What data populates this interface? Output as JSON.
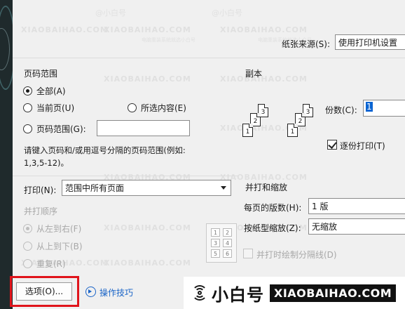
{
  "paper_source": {
    "label": "纸张来源(S):",
    "value": "使用打印机设置"
  },
  "page_range": {
    "heading": "页码范围",
    "all": "全部(A)",
    "current": "当前页(U)",
    "selection": "所选内容(E)",
    "pages": "页码范围(G):",
    "pages_value": "",
    "hint_line1": "请键入页码和/或用逗号分隔的页码范围(例如:",
    "hint_line2": "1,3,5-12)。"
  },
  "copies": {
    "heading": "副本",
    "count_label": "份数(C):",
    "count_value": "1",
    "collate": "逐份打印(T)",
    "collate_checked": true,
    "stack_a": [
      "1",
      "2",
      "3"
    ],
    "stack_b": [
      "1",
      "2",
      "3"
    ]
  },
  "print_what": {
    "label": "打印(N):",
    "value": "范围中所有页面"
  },
  "order": {
    "heading": "并打顺序",
    "ltr": "从左到右(F)",
    "ttb": "从上到下(B)",
    "repeat": "重复(R)",
    "grid": [
      "1",
      "2",
      "3",
      "4",
      "5",
      "6"
    ]
  },
  "zoom": {
    "heading": "并打和缩放",
    "pages_per_sheet_label": "每页的版数(H):",
    "pages_per_sheet_value": "1 版",
    "scale_label": "按纸型缩放(Z):",
    "scale_value": "无缩放",
    "draw_borders": "并打时绘制分隔线(D)"
  },
  "footer": {
    "options_button": "选项(O)...",
    "tips_link": "操作技巧"
  },
  "watermark": {
    "cn": "@小白号",
    "en": "XIAOBAIHAO.COM",
    "small": "电脑重装系统就选小白号"
  },
  "brand": {
    "cn": "小白号",
    "en": "XIAOBAIHAO.COM"
  },
  "colors": {
    "accent": "#1a64c7",
    "highlight": "#e0141b"
  }
}
